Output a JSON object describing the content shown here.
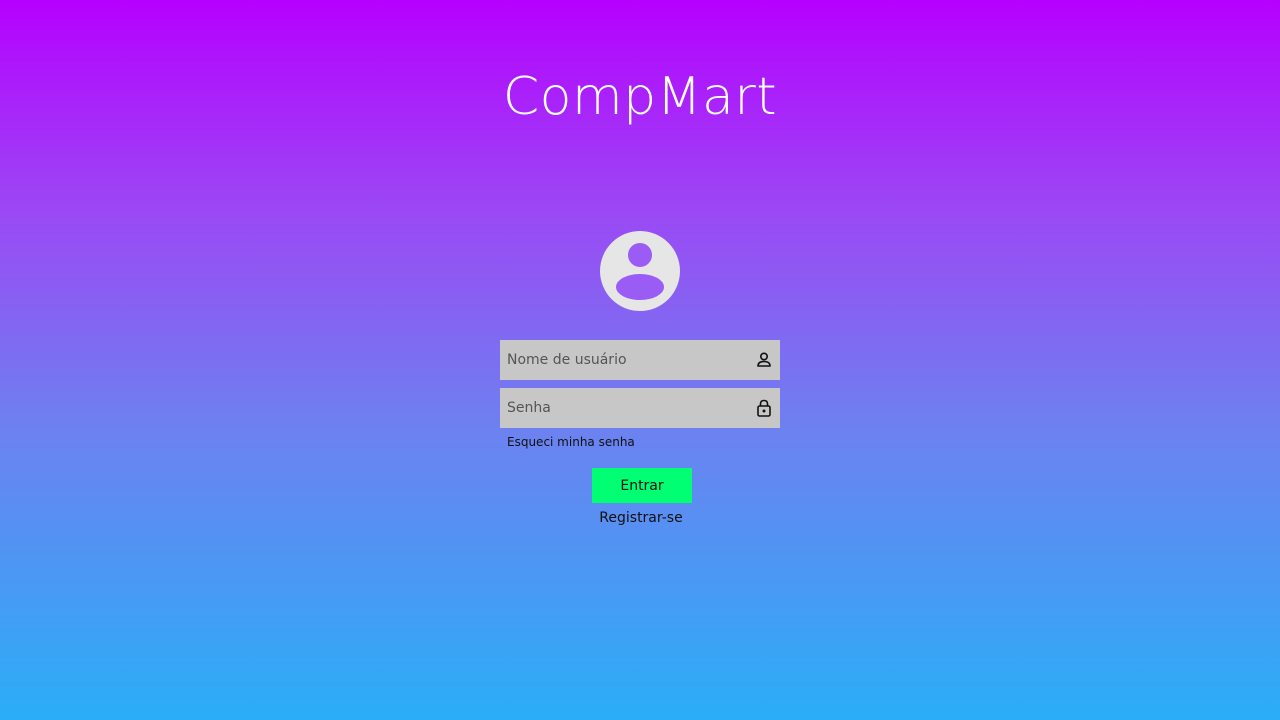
{
  "brand": {
    "name": "CompMart"
  },
  "login_form": {
    "username": {
      "value": "",
      "placeholder": "Nome de usuário",
      "icon": "user-icon"
    },
    "password": {
      "value": "",
      "placeholder": "Senha",
      "icon": "lock-icon"
    },
    "forgot_password_label": "Esqueci minha senha",
    "submit_label": "Entrar",
    "register_label": "Registrar-se"
  },
  "colors": {
    "gradient_top": "#b600ff",
    "gradient_bottom": "#2aaef6",
    "submit_button": "#00ff73",
    "input_background": "#c7c7c7",
    "avatar_background": "#e6e6e6",
    "avatar_figure": "#9a5cf4"
  }
}
